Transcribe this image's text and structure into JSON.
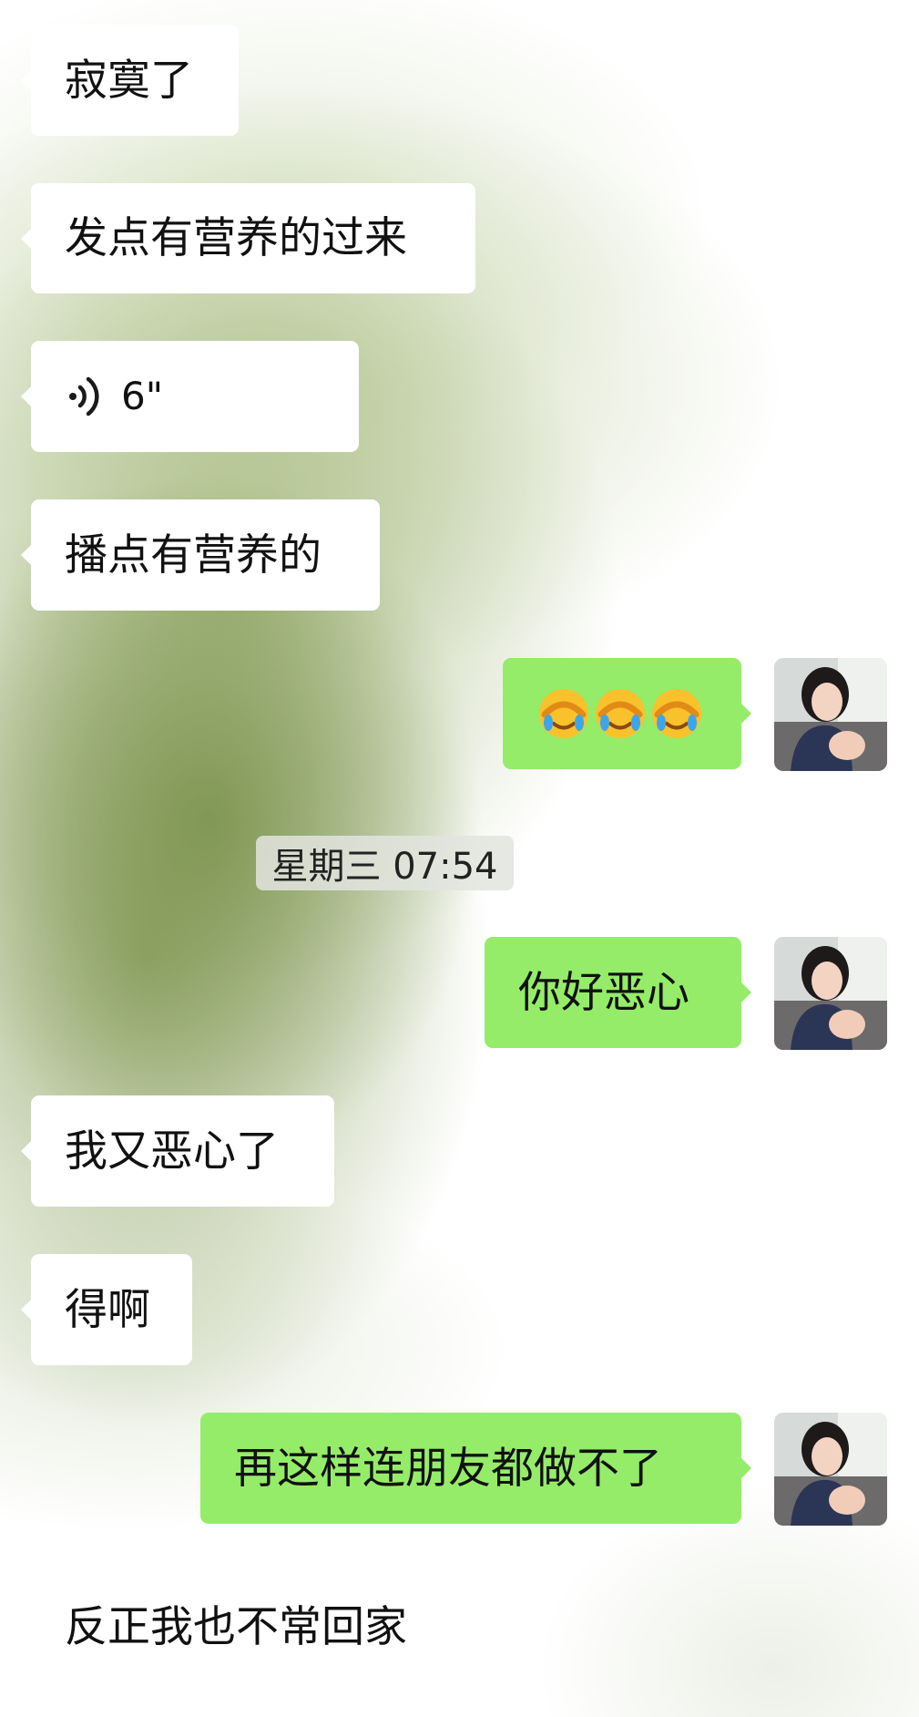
{
  "conversation": {
    "messages": [
      {
        "side": "left",
        "text": "寂寞了"
      },
      {
        "side": "left",
        "text": "发点有营养的过来"
      },
      {
        "side": "left",
        "type": "voice",
        "duration": "6\""
      },
      {
        "side": "left",
        "text": "播点有营养的"
      },
      {
        "side": "right",
        "type": "emoji",
        "emoji": [
          "facepalm-tears-emoji",
          "facepalm-tears-emoji",
          "facepalm-tears-emoji"
        ]
      },
      {
        "type": "timestamp",
        "text": "星期三 07:54"
      },
      {
        "side": "right",
        "text": "你好恶心"
      },
      {
        "side": "left",
        "text": "我又恶心了"
      },
      {
        "side": "left",
        "text": "得啊"
      },
      {
        "side": "right",
        "text": "再这样连朋友都做不了"
      },
      {
        "side": "left",
        "text": "反正我也不常回家"
      }
    ]
  },
  "colors": {
    "sent_bubble": "#95ec69",
    "received_bubble": "#ffffff",
    "text": "#111111",
    "timestamp_bg": "#e2e4de"
  }
}
